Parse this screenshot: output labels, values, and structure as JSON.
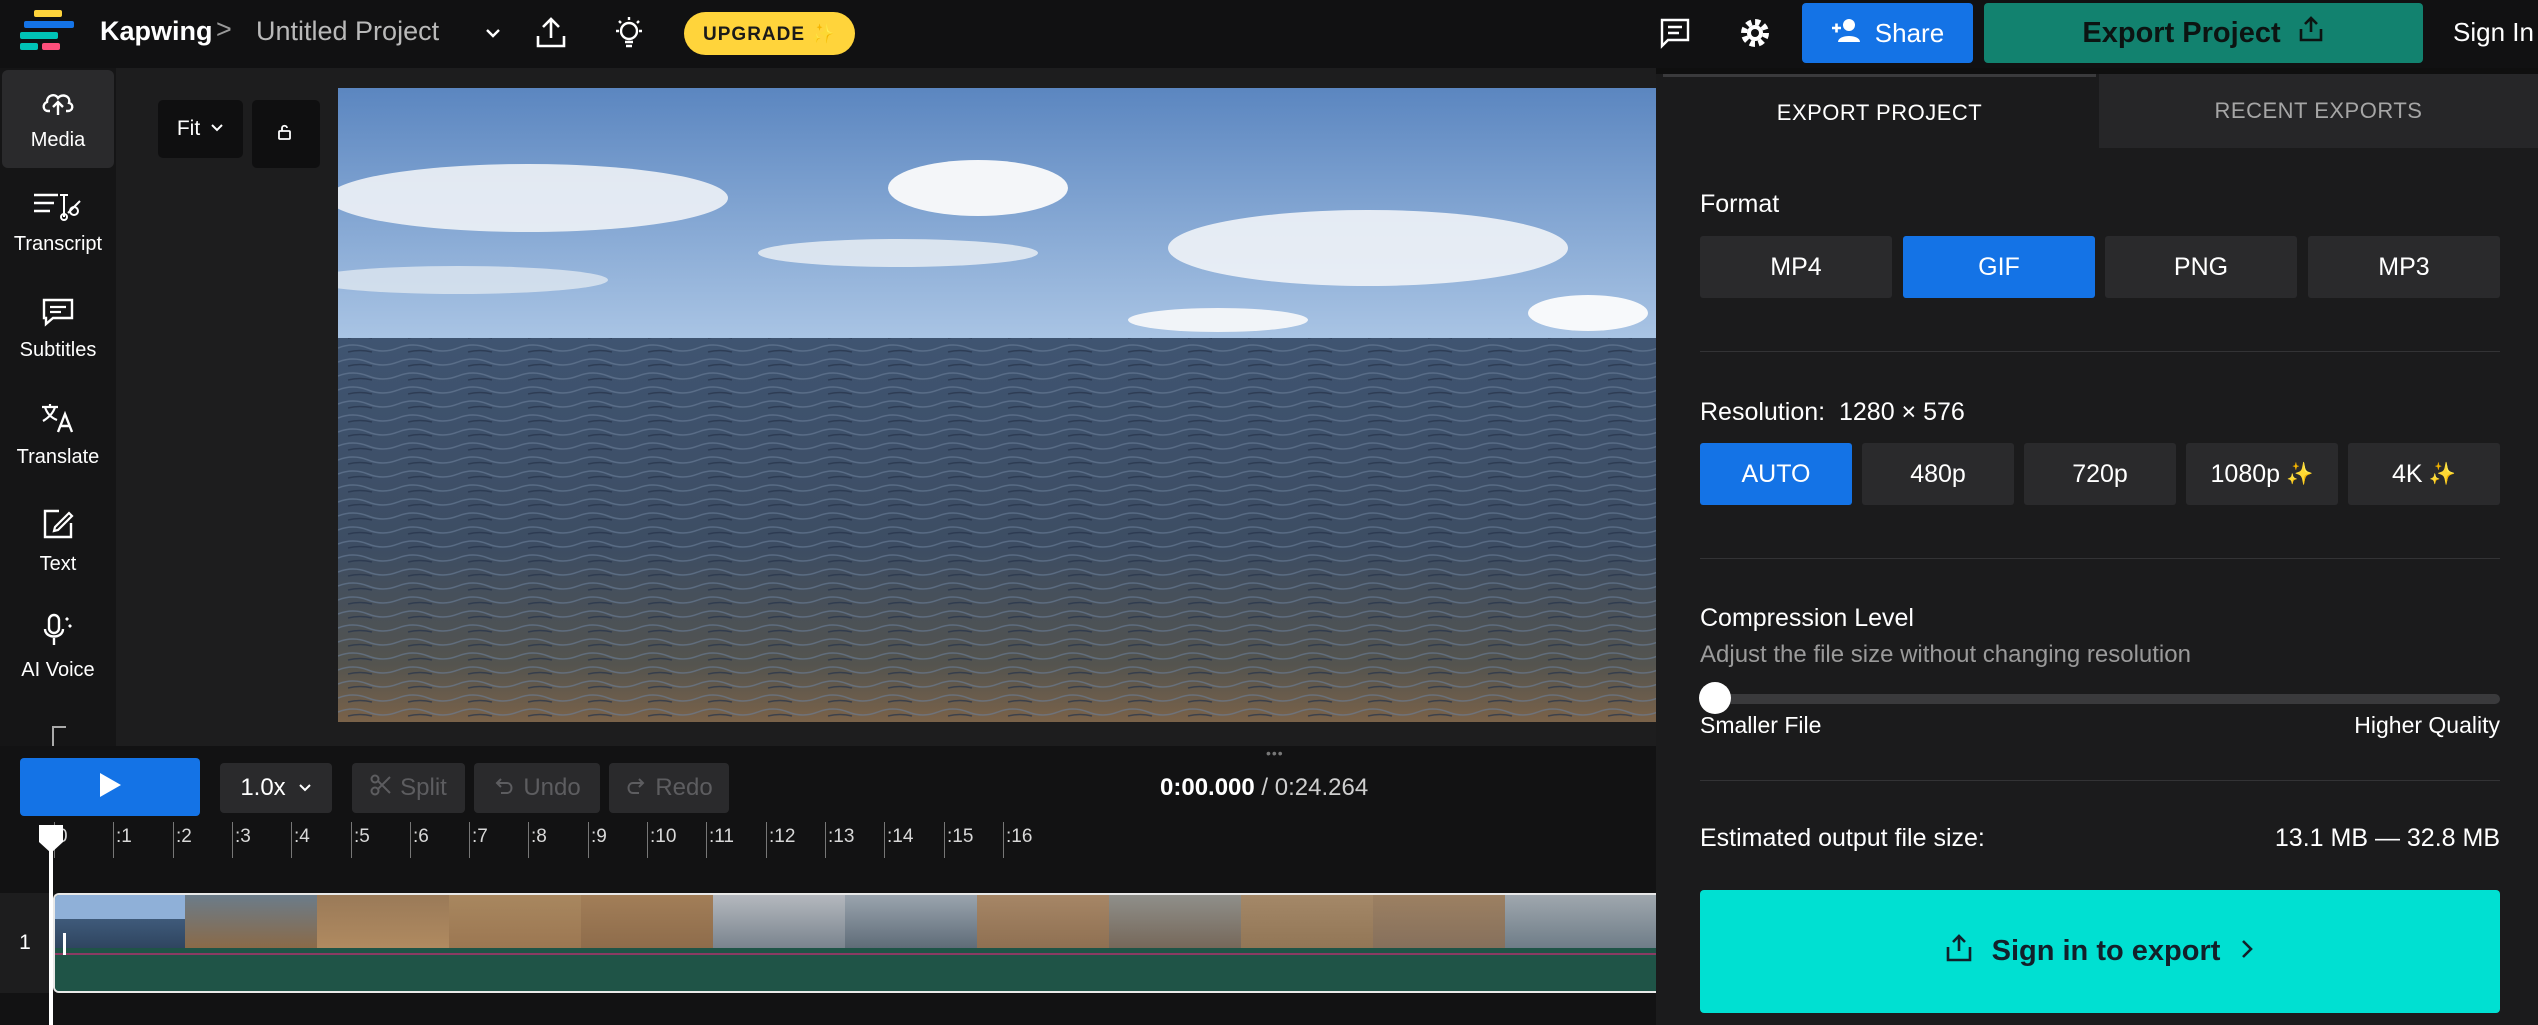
{
  "app": {
    "brand": "Kapwing",
    "breadcrumb_sep": ">",
    "project_title": "Untitled Project",
    "upgrade_label": "UPGRADE ✨",
    "share_label": "Share",
    "export_label": "Export Project",
    "signin_label": "Sign In"
  },
  "sidebar": {
    "items": [
      {
        "label": "Media",
        "icon": "upload-cloud-icon",
        "active": true
      },
      {
        "label": "Transcript",
        "icon": "transcript-icon"
      },
      {
        "label": "Subtitles",
        "icon": "subtitles-icon"
      },
      {
        "label": "Translate",
        "icon": "translate-icon"
      },
      {
        "label": "Text",
        "icon": "text-edit-icon"
      },
      {
        "label": "AI Voice",
        "icon": "ai-voice-icon"
      }
    ]
  },
  "canvas": {
    "fit_label": "Fit"
  },
  "timeline": {
    "speed": "1.0x",
    "split_label": "Split",
    "undo_label": "Undo",
    "redo_label": "Redo",
    "current_time": "0:00.000",
    "total_time": " / 0:24.264",
    "ruler_labels": [
      "0",
      ":1",
      ":2",
      ":3",
      ":4",
      ":5",
      ":6",
      ":7",
      ":8",
      ":9",
      ":10",
      ":11",
      ":12",
      ":13",
      ":14",
      ":15",
      ":16"
    ],
    "track_number": "1"
  },
  "export_panel": {
    "tab_export": "EXPORT PROJECT",
    "tab_recent": "RECENT EXPORTS",
    "format_label": "Format",
    "formats": [
      "MP4",
      "GIF",
      "PNG",
      "MP3"
    ],
    "format_selected": "GIF",
    "resolution_label": "Resolution:",
    "resolution_value": "1280 × 576",
    "resolutions": [
      "AUTO",
      "480p",
      "720p",
      "1080p",
      "4K"
    ],
    "resolution_selected": "AUTO",
    "compression_label": "Compression Level",
    "compression_sub": "Adjust the file size without changing resolution",
    "compression_level": 0,
    "slider_min_label": "Smaller File",
    "slider_max_label": "Higher Quality",
    "estimate_label": "Estimated output file size:",
    "estimate_value": "13.1 MB — 32.8 MB",
    "signin_export_label": "Sign in to export"
  },
  "colors": {
    "accent_blue": "#1473e6",
    "export_teal": "#12826f",
    "cta_cyan": "#00e0d2",
    "upgrade_yellow": "#ffd43b"
  }
}
